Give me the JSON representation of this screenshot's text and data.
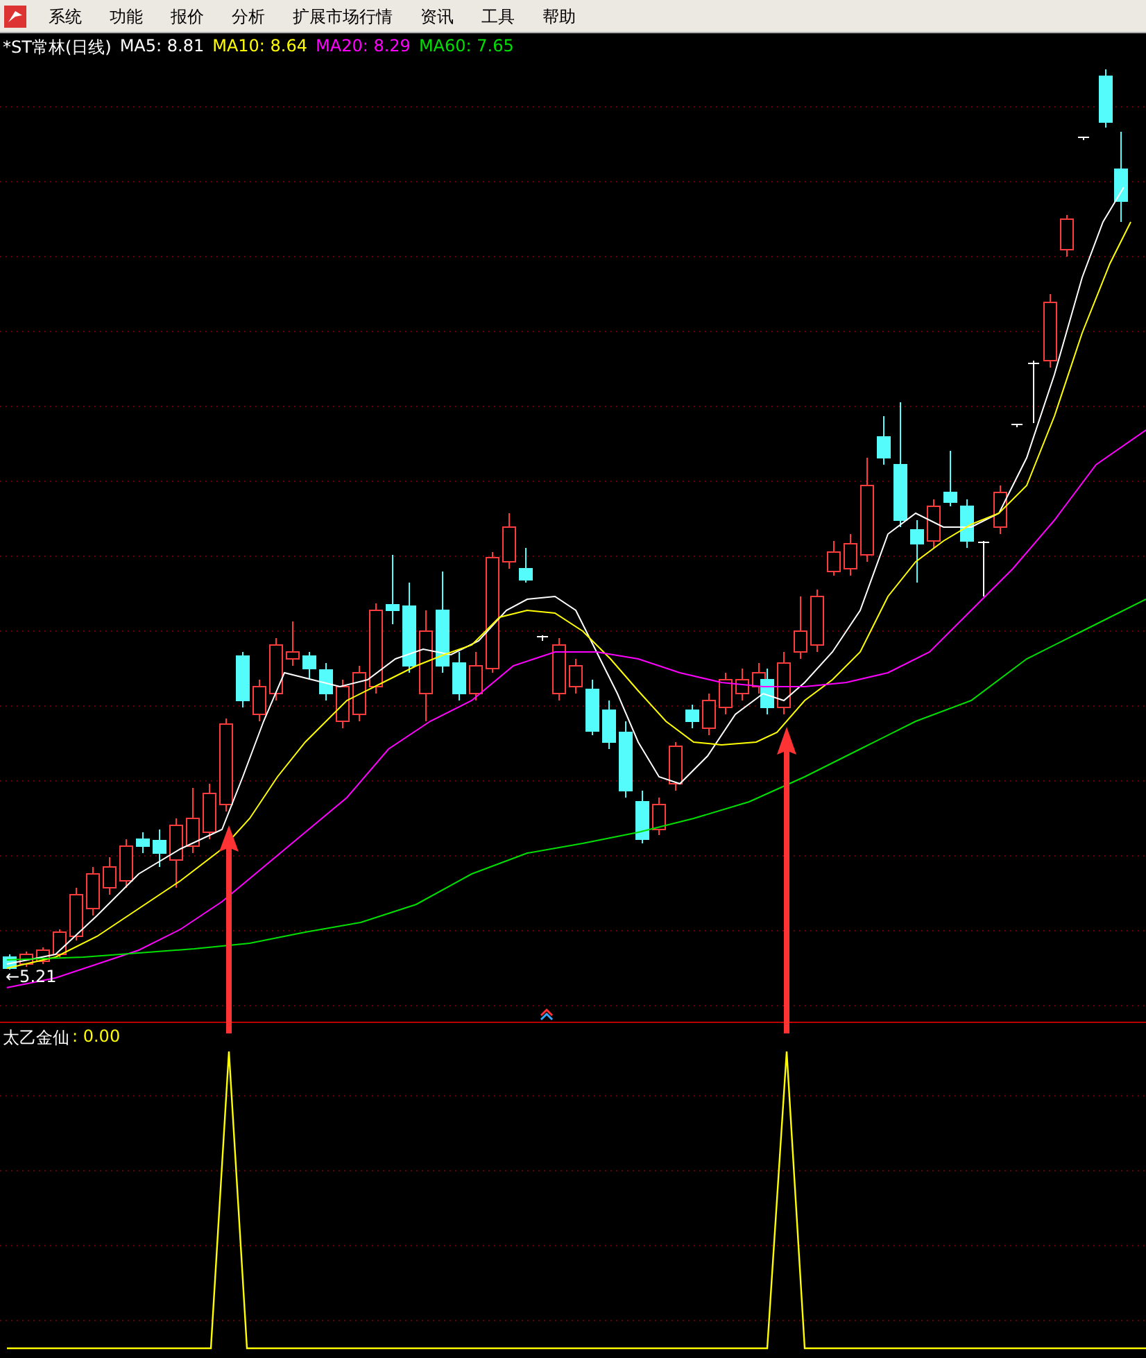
{
  "menu": [
    "系统",
    "功能",
    "报价",
    "分析",
    "扩展市场行情",
    "资讯",
    "工具",
    "帮助"
  ],
  "chart": {
    "title": "*ST常林(日线)",
    "legend": [
      {
        "text": "MA5: 8.81",
        "color": "#ffffff"
      },
      {
        "text": "MA10: 8.64",
        "color": "#ffff00"
      },
      {
        "text": "MA20: 8.29",
        "color": "#ff00ff"
      },
      {
        "text": "MA60: 7.65",
        "color": "#00e000"
      }
    ],
    "low_marker": "←5.21"
  },
  "indicator": {
    "name": "太乙金仙",
    "value": ": 0.00"
  }
}
